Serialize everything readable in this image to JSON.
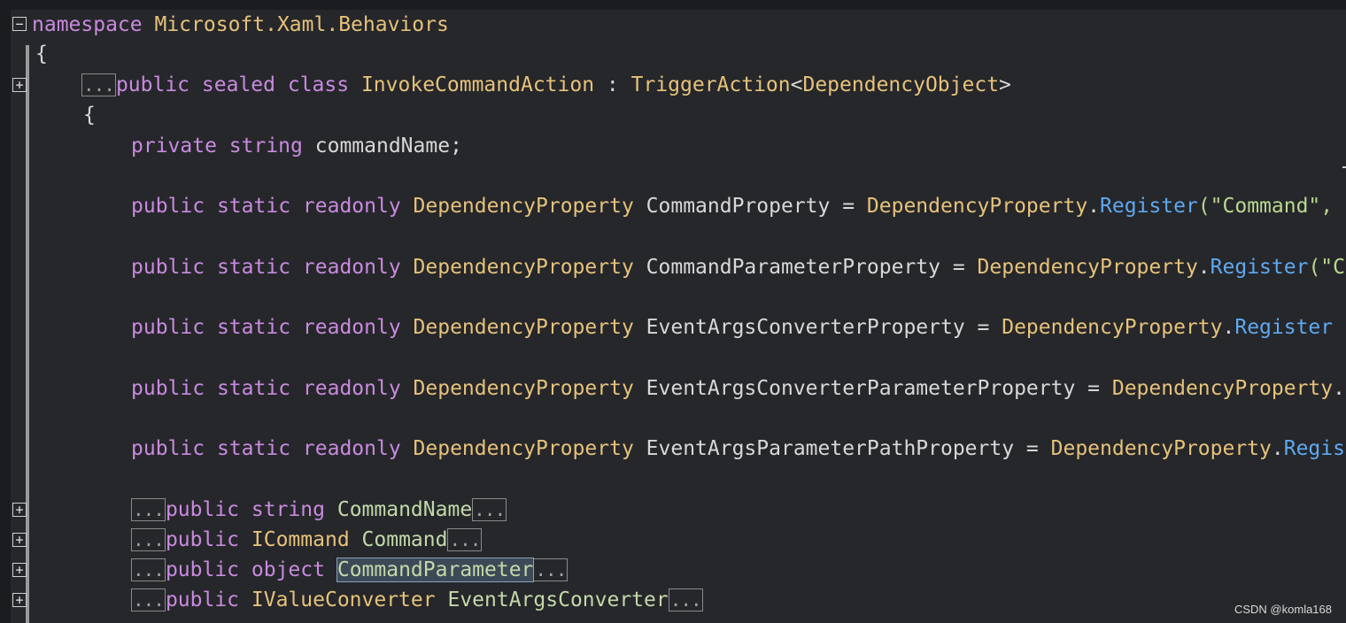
{
  "code": {
    "ellipsis": "...",
    "l1": {
      "kw": "namespace",
      "ns": "Microsoft.Xaml.Behaviors"
    },
    "l2": {
      "brace": "{"
    },
    "l3": {
      "kw1": "public",
      "kw2": "sealed",
      "kw3": "class",
      "name": "InvokeCommandAction",
      "sep": " : ",
      "base": "TriggerAction",
      "lt": "<",
      "arg": "DependencyObject",
      "gt": ">"
    },
    "l4": {
      "brace": "{"
    },
    "l5": {
      "kw1": "private",
      "kw2": "string",
      "name": "commandName",
      "semi": ";"
    },
    "fields": [
      {
        "kw1": "public",
        "kw2": "static",
        "kw3": "readonly",
        "type": "DependencyProperty",
        "name": "CommandProperty",
        "eq": " = ",
        "cls": "DependencyProperty",
        "dot": ".",
        "method": "Register",
        "tail": "(\"Command\","
      },
      {
        "kw1": "public",
        "kw2": "static",
        "kw3": "readonly",
        "type": "DependencyProperty",
        "name": "CommandParameterProperty",
        "eq": " = ",
        "cls": "DependencyProperty",
        "dot": ".",
        "method": "Register",
        "tail": "(\"C"
      },
      {
        "kw1": "public",
        "kw2": "static",
        "kw3": "readonly",
        "type": "DependencyProperty",
        "name": "EventArgsConverterProperty",
        "eq": " = ",
        "cls": "DependencyProperty",
        "dot": ".",
        "method": "Register",
        "tail": ""
      },
      {
        "kw1": "public",
        "kw2": "static",
        "kw3": "readonly",
        "type": "DependencyProperty",
        "name": "EventArgsConverterParameterProperty",
        "eq": " = ",
        "cls": "DependencyProperty",
        "dot": ".",
        "method": "",
        "tail": ""
      },
      {
        "kw1": "public",
        "kw2": "static",
        "kw3": "readonly",
        "type": "DependencyProperty",
        "name": "EventArgsParameterPathProperty",
        "eq": " = ",
        "cls": "DependencyProperty",
        "dot": ".",
        "method": "Regis",
        "tail": ""
      }
    ],
    "props": [
      {
        "kw": "public",
        "type": "string",
        "name": "CommandName"
      },
      {
        "kw": "public",
        "type": "ICommand",
        "name": "Command"
      },
      {
        "kw": "public",
        "type": "object",
        "name": "CommandParameter"
      },
      {
        "kw": "public",
        "type": "IValueConverter",
        "name": "EventArgsConverter"
      }
    ]
  },
  "watermark": "CSDN @komla168"
}
